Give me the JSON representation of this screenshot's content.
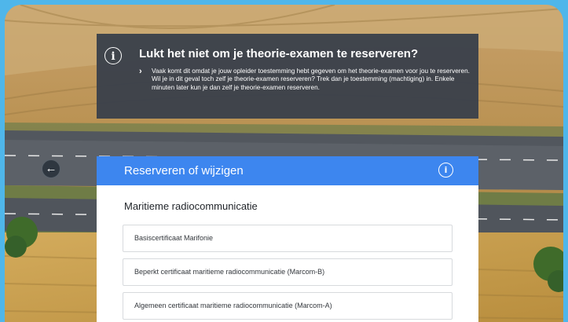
{
  "info_banner": {
    "icon": "info-icon",
    "title": "Lukt het niet om je theorie-examen te reserveren?",
    "body": "Vaak komt dit omdat je jouw opleider toestemming hebt gegeven om het theorie-examen voor jou te reserveren. Wil je in dit geval toch zelf je theorie-examen reserveren? Trek dan je toestemming (machtiging) in. Enkele minuten later kun je dan zelf je theorie-examen reserveren."
  },
  "nav": {
    "back_icon": "back-arrow-icon"
  },
  "panel": {
    "title": "Reserveren of wijzigen",
    "help_icon": "info-icon",
    "header_color": "#3d86ef",
    "section_title": "Maritieme radiocommunicatie",
    "options": [
      {
        "label": "Basiscertificaat Marifonie"
      },
      {
        "label": "Beperkt certificaat maritieme radiocommunicatie (Marcom-B)"
      },
      {
        "label": "Algemeen certificaat maritieme radiocommunicatie (Marcom-A)"
      }
    ]
  }
}
